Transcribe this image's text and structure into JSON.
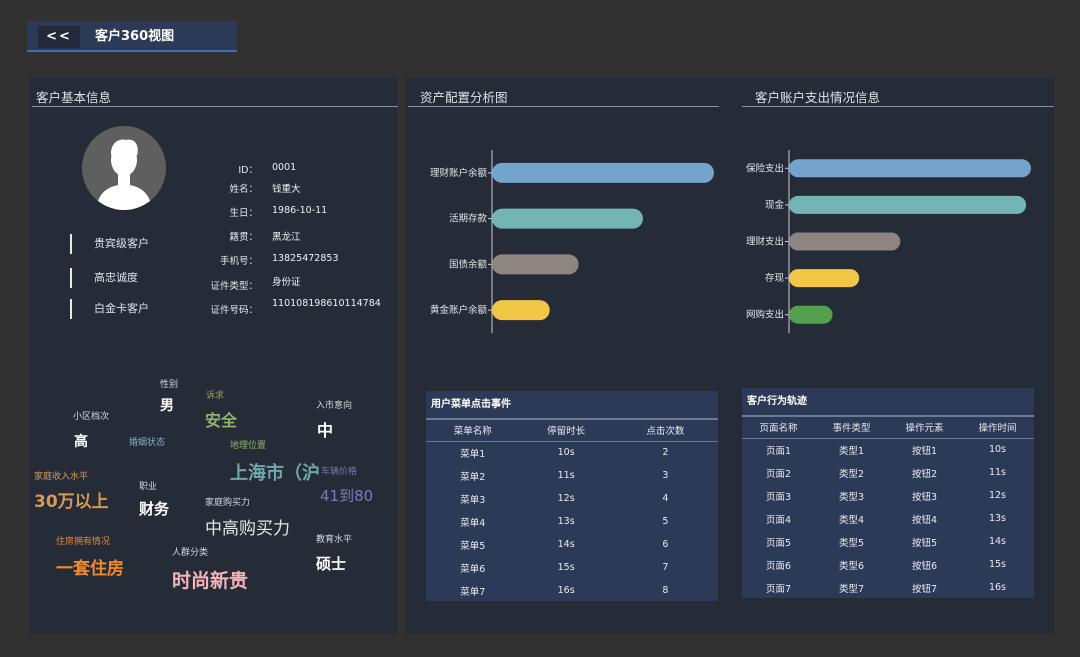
{
  "header": {
    "back_label": "<<",
    "title": "客户360视图"
  },
  "basic_info": {
    "title": "客户基本信息",
    "tags": [
      "贵宾级客户",
      "高忠诚度",
      "白金卡客户"
    ],
    "fields": [
      {
        "label": "ID：",
        "value": "0001"
      },
      {
        "label": "姓名：",
        "value": "钱重大"
      },
      {
        "label": "生日：",
        "value": "1986-10-11"
      },
      {
        "label": "籍贯：",
        "value": "黑龙江"
      },
      {
        "label": "手机号：",
        "value": "13825472853"
      },
      {
        "label": "证件类型：",
        "value": "身份证"
      },
      {
        "label": "证件号码：",
        "value": "110108198610114784"
      }
    ],
    "word_cloud": {
      "gender_label": "性别",
      "gender": "男",
      "appeal_label": "诉求",
      "appeal": "安全",
      "community_label": "小区档次",
      "community": "高",
      "marriage_label": "婚姻状态",
      "intent_label": "入市意向",
      "intent": "中",
      "location_label": "地理位置",
      "location": "上海市（沪",
      "car_label": "车辆价格",
      "car": "41到80",
      "income_label": "家庭收入水平",
      "income": "30万以上",
      "job_label": "职业",
      "job": "财务",
      "purchase_label": "家庭购买力",
      "purchase": "中高购买力",
      "house_label": "住房拥有情况",
      "house": "一套住房",
      "crowd_label": "人群分类",
      "crowd": "时尚新贵",
      "edu_label": "教育水平",
      "edu": "硕士"
    }
  },
  "asset_chart": {
    "title": "资产配置分析图",
    "chart_data": {
      "type": "bar",
      "orientation": "horizontal",
      "categories": [
        "理财账户余额",
        "活期存款",
        "国债余额",
        "黄金账户余额"
      ],
      "values": [
        100,
        68,
        39,
        26
      ],
      "colors": [
        "#74a4cb",
        "#73b5b2",
        "#8e8583",
        "#f1c845"
      ]
    }
  },
  "expense_chart": {
    "title": "客户账户支出情况信息",
    "chart_data": {
      "type": "bar",
      "orientation": "horizontal",
      "categories": [
        "保险支出",
        "现金",
        "理财支出",
        "存现",
        "网购支出"
      ],
      "values": [
        100,
        98,
        46,
        29,
        18
      ],
      "colors": [
        "#74a4cb",
        "#73b5b2",
        "#8e8583",
        "#f1c845",
        "#55a04e"
      ]
    }
  },
  "menu_table": {
    "title": "用户菜单点击事件",
    "headers": [
      "菜单名称",
      "停留时长",
      "点击次数"
    ],
    "rows": [
      [
        "菜单1",
        "10s",
        "2"
      ],
      [
        "菜单2",
        "11s",
        "3"
      ],
      [
        "菜单3",
        "12s",
        "4"
      ],
      [
        "菜单4",
        "13s",
        "5"
      ],
      [
        "菜单5",
        "14s",
        "6"
      ],
      [
        "菜单6",
        "15s",
        "7"
      ],
      [
        "菜单7",
        "16s",
        "8"
      ]
    ]
  },
  "behavior_table": {
    "title": "客户行为轨迹",
    "headers": [
      "页面名称",
      "事件类型",
      "操作元素",
      "操作时间"
    ],
    "rows": [
      [
        "页面1",
        "类型1",
        "按钮1",
        "10s"
      ],
      [
        "页面2",
        "类型2",
        "按钮2",
        "11s"
      ],
      [
        "页面3",
        "类型3",
        "按钮3",
        "12s"
      ],
      [
        "页面4",
        "类型4",
        "按钮4",
        "13s"
      ],
      [
        "页面5",
        "类型5",
        "按钮5",
        "14s"
      ],
      [
        "页面6",
        "类型6",
        "按钮6",
        "15s"
      ],
      [
        "页面7",
        "类型7",
        "按钮7",
        "16s"
      ]
    ]
  },
  "colors": {
    "page_bg": "#313131",
    "panel_bg": "#262b38",
    "header_bg": "#2c3a57",
    "accent_blue": "#3e6bb1"
  }
}
